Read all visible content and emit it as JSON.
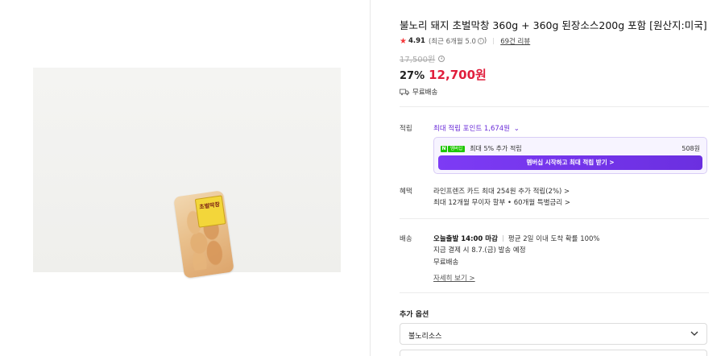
{
  "product": {
    "title": "불노리 돼지 초벌막창 360g + 360g 된장소스200g 포함 [원산지:미국]",
    "image_label": "초벌막창",
    "rating": "4.91",
    "rating_sub": "(최근 6개월 5.0",
    "rating_sub_close": ")",
    "review_count": "69건 리뷰",
    "original_price": "17,500원",
    "discount": "27%",
    "sale_price": "12,700원",
    "shipping": "무료배송"
  },
  "reward": {
    "label": "적립",
    "link_text": "최대 적립 포인트 1,674원",
    "membership_line": "최대 5% 추가 적립",
    "membership_badge_n": "N",
    "membership_badge_plus": "멤버십",
    "membership_amount": "508원",
    "membership_button": "멤버십 시작하고 최대 적립 받기 >"
  },
  "benefit": {
    "label": "혜택",
    "line1": "라인프렌즈 카드 최대 254원 추가 적립(2%) >",
    "line2": "최대 12개월 무이자 할부 • 60개월 특별금리 >"
  },
  "delivery": {
    "label": "배송",
    "today": "오늘출발 14:00 마감",
    "eta": "평균 2일 이내 도착 확률 100%",
    "pay_now": "지금 결제 시 8.7.(금) 발송 예정",
    "fee": "무료배송",
    "more": "자세히 보기 >"
  },
  "options": {
    "title": "추가 옵션",
    "selected": "불노리소스"
  },
  "colors": {
    "sale_red": "#e01f3d",
    "reward_purple": "#6a2bd8",
    "naver_green": "#1ec800",
    "star_red": "#f5383b"
  }
}
